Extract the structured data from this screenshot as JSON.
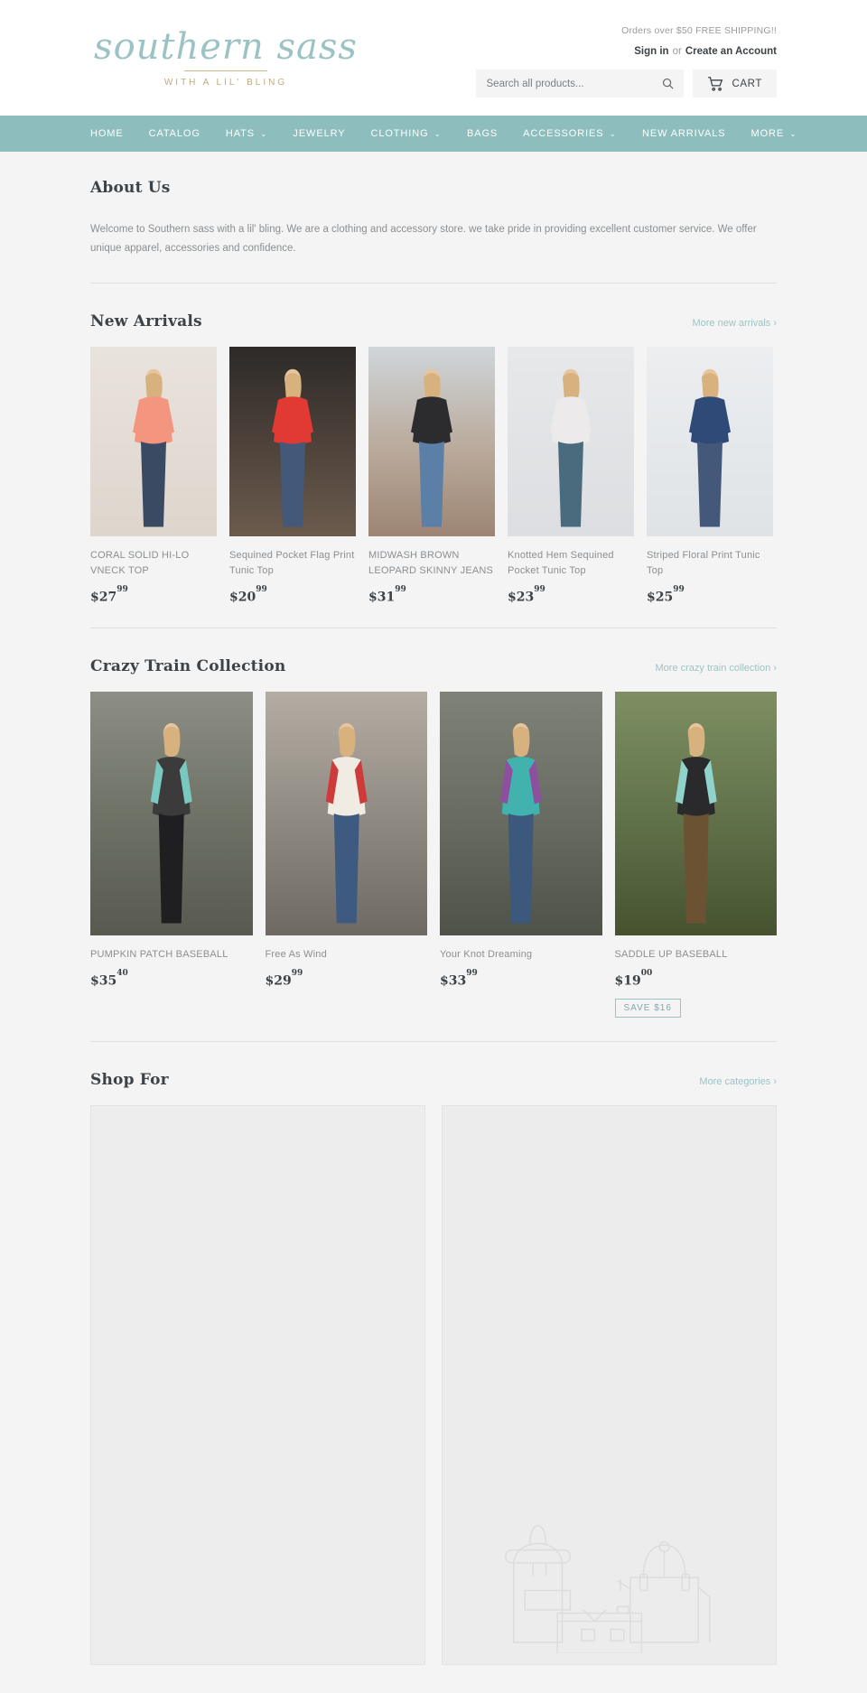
{
  "header": {
    "logo_script": "southern sass",
    "logo_sub": "WITH A LIL' BLING",
    "shipping_note": "Orders over $50 FREE SHIPPING!!",
    "sign_in": "Sign in",
    "or": "or",
    "create_account": "Create an Account",
    "search_placeholder": "Search all products...",
    "search_value": "",
    "cart_label": "CART",
    "search_icon": "search-icon",
    "cart_icon": "shopping-cart-icon"
  },
  "nav": {
    "items": [
      {
        "label": "HOME",
        "caret": false
      },
      {
        "label": "CATALOG",
        "caret": false
      },
      {
        "label": "HATS",
        "caret": true
      },
      {
        "label": "JEWELRY",
        "caret": false
      },
      {
        "label": "CLOTHING",
        "caret": true
      },
      {
        "label": "BAGS",
        "caret": false
      },
      {
        "label": "ACCESSORIES",
        "caret": true
      },
      {
        "label": "NEW ARRIVALS",
        "caret": false
      },
      {
        "label": "MORE",
        "caret": true
      }
    ]
  },
  "about": {
    "title": "About Us",
    "body": "Welcome to Southern sass with a lil' bling. We are a clothing and accessory store. we take pride in providing excellent customer service. We offer unique apparel, accessories and confidence."
  },
  "new_arrivals": {
    "title": "New Arrivals",
    "more_link": "More new arrivals ›",
    "products": [
      {
        "title": "CORAL SOLID HI-LO VNECK TOP",
        "price_dollars": "$27",
        "price_cents": "99"
      },
      {
        "title": "Sequined Pocket Flag Print Tunic Top",
        "price_dollars": "$20",
        "price_cents": "99"
      },
      {
        "title": "MIDWASH BROWN LEOPARD SKINNY JEANS",
        "price_dollars": "$31",
        "price_cents": "99"
      },
      {
        "title": "Knotted Hem Sequined Pocket Tunic Top",
        "price_dollars": "$23",
        "price_cents": "99"
      },
      {
        "title": "Striped Floral Print Tunic Top",
        "price_dollars": "$25",
        "price_cents": "99"
      }
    ]
  },
  "crazy_train": {
    "title": "Crazy Train Collection",
    "more_link": "More crazy train collection ›",
    "products": [
      {
        "title": "PUMPKIN PATCH BASEBALL",
        "price_dollars": "$35",
        "price_cents": "40",
        "badge": ""
      },
      {
        "title": "Free As Wind",
        "price_dollars": "$29",
        "price_cents": "99",
        "badge": ""
      },
      {
        "title": "Your Knot Dreaming",
        "price_dollars": "$33",
        "price_cents": "99",
        "badge": ""
      },
      {
        "title": "SADDLE UP BASEBALL",
        "price_dollars": "$19",
        "price_cents": "00",
        "badge": "SAVE $16"
      }
    ]
  },
  "shop_for": {
    "title": "Shop For",
    "more_link": "More categories ›",
    "cards": [
      {
        "name": "category-placeholder-empty"
      },
      {
        "name": "category-placeholder-bags"
      }
    ]
  },
  "colors": {
    "nav_teal": "#8ebdbd",
    "accent_link": "#9cc3c4",
    "page_bg": "#f4f4f4",
    "text": "#3d4246",
    "muted": "#8b8f92"
  }
}
